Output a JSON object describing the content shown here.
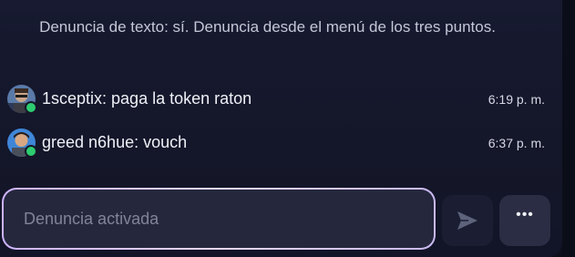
{
  "system_note": {
    "text": "Denuncia de texto: sí. Denuncia desde el menú de los tres puntos."
  },
  "messages": [
    {
      "author": "1sceptix",
      "text": "1sceptix: paga la token raton",
      "time": "6:19 p. m.",
      "status": "online",
      "avatar_icon": "user-avatar-icon"
    },
    {
      "author": "greed n6hue",
      "text": "greed n6hue: vouch",
      "time": "6:37 p. m.",
      "status": "online",
      "avatar_icon": "user-avatar-icon"
    }
  ],
  "composer": {
    "placeholder": "Denuncia activada",
    "send_icon": "send-icon",
    "more_label": "•••",
    "more_icon": "more-options-icon"
  },
  "colors": {
    "online": "#2ecc71",
    "input_border": "#d8c6ff",
    "panel_bg": "#161930"
  }
}
